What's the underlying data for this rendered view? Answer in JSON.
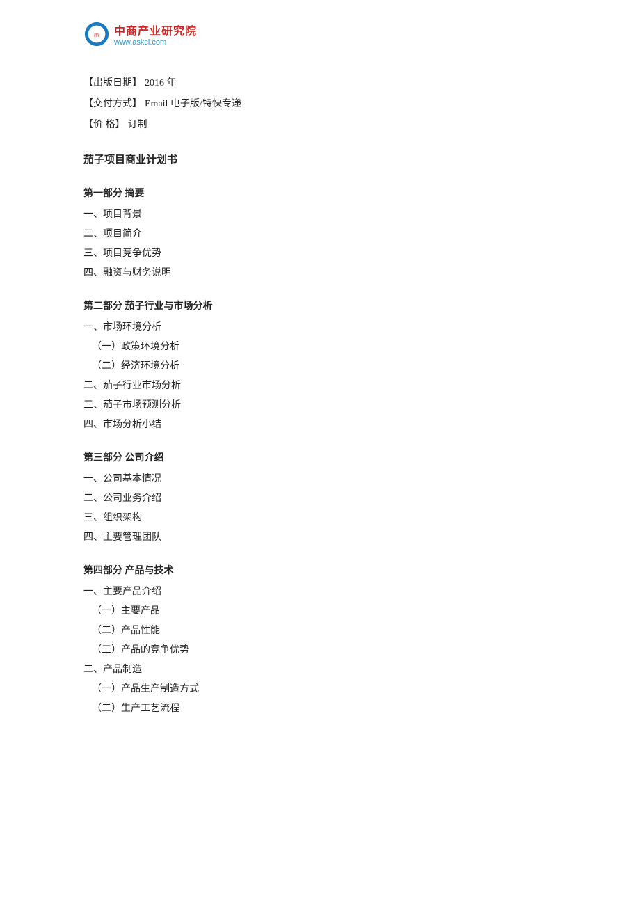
{
  "logo": {
    "name": "中商产业研究院",
    "url": "www.askci.com"
  },
  "meta": {
    "publish_label": "【出版日期】",
    "publish_value": "2016 年",
    "delivery_label": "【交付方式】",
    "delivery_value": "Email 电子版/特快专递",
    "price_label": "【价         格】",
    "price_value": "订制"
  },
  "doc_title": "茄子项目商业计划书",
  "sections": [
    {
      "header": "第一部分  摘要",
      "items": [
        {
          "text": "一、项目背景",
          "level": 1
        },
        {
          "text": "二、项目简介",
          "level": 1
        },
        {
          "text": "三、项目竞争优势",
          "level": 1
        },
        {
          "text": "四、融资与财务说明",
          "level": 1
        }
      ]
    },
    {
      "header": "第二部分  茄子行业与市场分析",
      "items": [
        {
          "text": "一、市场环境分析",
          "level": 1
        },
        {
          "text": "（一）政策环境分析",
          "level": 2
        },
        {
          "text": "（二）经济环境分析",
          "level": 2
        },
        {
          "text": "二、茄子行业市场分析",
          "level": 1
        },
        {
          "text": "三、茄子市场预测分析",
          "level": 1
        },
        {
          "text": "四、市场分析小结",
          "level": 1
        }
      ]
    },
    {
      "header": "第三部分  公司介绍",
      "items": [
        {
          "text": "一、公司基本情况",
          "level": 1
        },
        {
          "text": "二、公司业务介绍",
          "level": 1
        },
        {
          "text": "三、组织架构",
          "level": 1
        },
        {
          "text": "四、主要管理团队",
          "level": 1
        }
      ]
    },
    {
      "header": "第四部分  产品与技术",
      "items": [
        {
          "text": "一、主要产品介绍",
          "level": 1
        },
        {
          "text": "（一）主要产品",
          "level": 2
        },
        {
          "text": "（二）产品性能",
          "level": 2
        },
        {
          "text": "（三）产品的竞争优势",
          "level": 2
        },
        {
          "text": "二、产品制造",
          "level": 1
        },
        {
          "text": "（一）产品生产制造方式",
          "level": 2
        },
        {
          "text": "（二）生产工艺流程",
          "level": 2
        }
      ]
    }
  ]
}
